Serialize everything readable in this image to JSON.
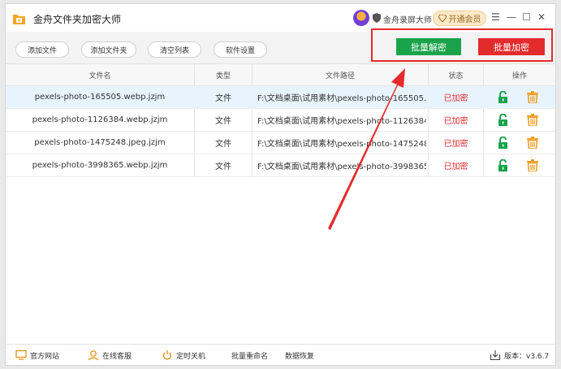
{
  "app": {
    "title": "金舟文件夹加密大师",
    "promo_text": "金舟录屏大师",
    "vip_label": "开通会员",
    "window_controls": {
      "menu": "☰",
      "minimize": "—",
      "maximize": "☐",
      "close": "✕"
    }
  },
  "toolbar": {
    "add_file": "添加文件",
    "add_folder": "添加文件夹",
    "clear_list": "清空列表",
    "settings": "软件设置",
    "batch_decrypt": "批量解密",
    "batch_encrypt": "批量加密"
  },
  "colors": {
    "decrypt_green": "#1aa34a",
    "encrypt_red": "#e32b2b",
    "highlight_red": "#e52b2b",
    "unlock_green": "#16a34a",
    "delete_orange": "#f29a1a"
  },
  "table": {
    "headers": [
      "文件名",
      "类型",
      "文件路径",
      "状态",
      "操作"
    ],
    "rows": [
      {
        "name": "pexels-photo-165505.webp.jzjm",
        "type": "文件",
        "path": "F:\\文档桌面\\试用素材\\pexels-photo-165505.w...",
        "status": "已加密",
        "selected": true
      },
      {
        "name": "pexels-photo-1126384.webp.jzjm",
        "type": "文件",
        "path": "F:\\文档桌面\\试用素材\\pexels-photo-1126384....",
        "status": "已加密",
        "selected": false
      },
      {
        "name": "pexels-photo-1475248.jpeg.jzjm",
        "type": "文件",
        "path": "F:\\文档桌面\\试用素材\\pexels-photo-1475248.j...",
        "status": "已加密",
        "selected": false
      },
      {
        "name": "pexels-photo-3998365.webp.jzjm",
        "type": "文件",
        "path": "F:\\文档桌面\\试用素材\\pexels-photo-3998365....",
        "status": "已加密",
        "selected": false
      }
    ],
    "row_icons": [
      "unlock-icon",
      "trash-icon"
    ]
  },
  "footer": {
    "website": "官方网站",
    "support": "在线客服",
    "shutdown": "定时关机",
    "rename": "批量重命名",
    "recovery": "数据恢复",
    "version": "版本：v3.6.7"
  }
}
